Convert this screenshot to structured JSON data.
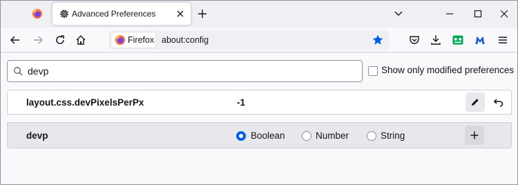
{
  "window": {
    "tab_title": "Advanced Preferences"
  },
  "navbar": {
    "identity_label": "Firefox",
    "url": "about:config"
  },
  "search": {
    "value": "devp"
  },
  "modified_only": {
    "label": "Show only modified preferences",
    "checked": false
  },
  "preferences": [
    {
      "name": "layout.css.devPixelsPerPx",
      "value": "-1"
    }
  ],
  "new_pref": {
    "name": "devp",
    "types": [
      "Boolean",
      "Number",
      "String"
    ],
    "selected_type": "Boolean"
  },
  "colors": {
    "accent": "#0061e0",
    "star": "#0061e0",
    "ext_green": "#00a651"
  },
  "icons": {
    "pinned_tab": "firefox-icon",
    "tab": "gear-icon",
    "edit": "pencil-icon",
    "reset": "undo-icon",
    "add": "plus-icon"
  }
}
